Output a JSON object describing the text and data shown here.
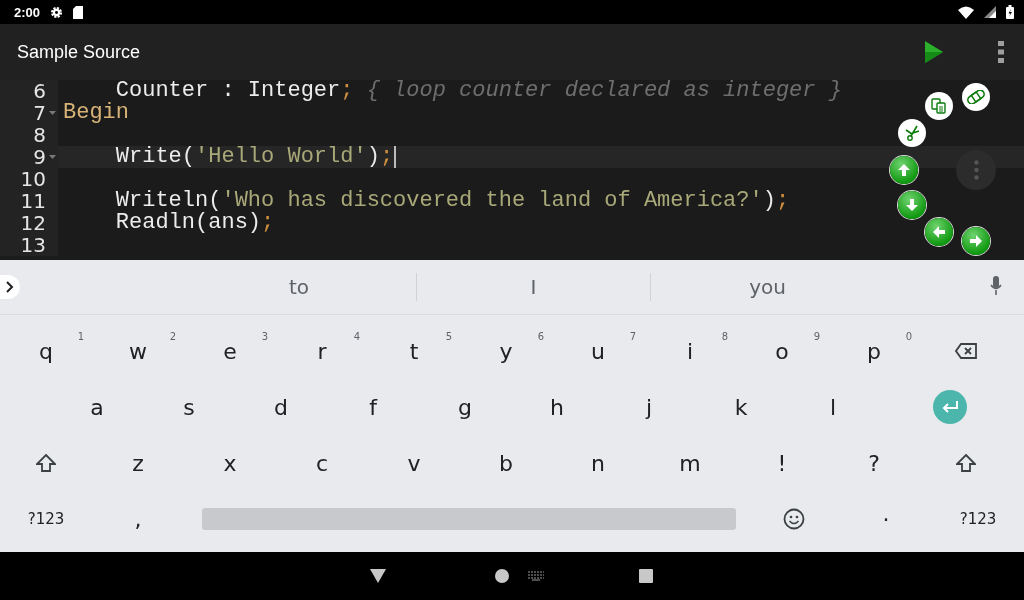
{
  "status_bar": {
    "time": "2:00"
  },
  "app_bar": {
    "title": "Sample Source"
  },
  "editor": {
    "lines": [
      {
        "number": "6",
        "foldable": false,
        "current": false,
        "tokens": [
          {
            "kind": "plain",
            "text": "    Counter : Integer"
          },
          {
            "kind": "punct",
            "text": ";"
          },
          {
            "kind": "comment",
            "text": " { loop counter declared as integer }"
          }
        ]
      },
      {
        "number": "7",
        "foldable": true,
        "current": false,
        "tokens": [
          {
            "kind": "keyword",
            "text": "Begin"
          }
        ]
      },
      {
        "number": "8",
        "foldable": false,
        "current": false
      },
      {
        "number": "9",
        "foldable": true,
        "current": true,
        "tokens": [
          {
            "kind": "plain",
            "text": "    Write("
          },
          {
            "kind": "string",
            "text": "'Hello World'"
          },
          {
            "kind": "plain",
            "text": ")"
          },
          {
            "kind": "punct",
            "text": ";"
          }
        ]
      },
      {
        "number": "10",
        "foldable": false,
        "current": false
      },
      {
        "number": "11",
        "foldable": false,
        "current": false,
        "tokens": [
          {
            "kind": "plain",
            "text": "    Writeln("
          },
          {
            "kind": "string",
            "text": "'Who has discovered the land of America?'"
          },
          {
            "kind": "plain",
            "text": ")"
          },
          {
            "kind": "punct",
            "text": ";"
          }
        ]
      },
      {
        "number": "12",
        "foldable": false,
        "current": false,
        "tokens": [
          {
            "kind": "plain",
            "text": "    Readln(ans)"
          },
          {
            "kind": "punct",
            "text": ";"
          }
        ]
      },
      {
        "number": "13",
        "foldable": false,
        "current": false
      }
    ]
  },
  "keyboard": {
    "suggestions": [
      "to",
      "I",
      "you"
    ],
    "rows": [
      [
        {
          "kind": "char",
          "label": "q",
          "hint": "1"
        },
        {
          "kind": "char",
          "label": "w",
          "hint": "2"
        },
        {
          "kind": "char",
          "label": "e",
          "hint": "3"
        },
        {
          "kind": "char",
          "label": "r",
          "hint": "4"
        },
        {
          "kind": "char",
          "label": "t",
          "hint": "5"
        },
        {
          "kind": "char",
          "label": "y",
          "hint": "6"
        },
        {
          "kind": "char",
          "label": "u",
          "hint": "7"
        },
        {
          "kind": "char",
          "label": "i",
          "hint": "8"
        },
        {
          "kind": "char",
          "label": "o",
          "hint": "9"
        },
        {
          "kind": "char",
          "label": "p",
          "hint": "0"
        },
        {
          "kind": "backspace"
        }
      ],
      [
        {
          "kind": "char",
          "label": "a"
        },
        {
          "kind": "char",
          "label": "s"
        },
        {
          "kind": "char",
          "label": "d"
        },
        {
          "kind": "char",
          "label": "f"
        },
        {
          "kind": "char",
          "label": "g"
        },
        {
          "kind": "char",
          "label": "h"
        },
        {
          "kind": "char",
          "label": "j"
        },
        {
          "kind": "char",
          "label": "k"
        },
        {
          "kind": "char",
          "label": "l"
        },
        {
          "kind": "enter"
        }
      ],
      [
        {
          "kind": "shift"
        },
        {
          "kind": "char",
          "label": "z"
        },
        {
          "kind": "char",
          "label": "x"
        },
        {
          "kind": "char",
          "label": "c"
        },
        {
          "kind": "char",
          "label": "v"
        },
        {
          "kind": "char",
          "label": "b"
        },
        {
          "kind": "char",
          "label": "n"
        },
        {
          "kind": "char",
          "label": "m"
        },
        {
          "kind": "char",
          "label": "!"
        },
        {
          "kind": "char",
          "label": "?"
        },
        {
          "kind": "shift"
        }
      ],
      [
        {
          "kind": "symbols",
          "label": "?123"
        },
        {
          "kind": "char",
          "label": ","
        },
        {
          "kind": "space"
        },
        {
          "kind": "emoji"
        },
        {
          "kind": "char",
          "label": "·"
        },
        {
          "kind": "symbols",
          "label": "?123"
        }
      ]
    ]
  }
}
